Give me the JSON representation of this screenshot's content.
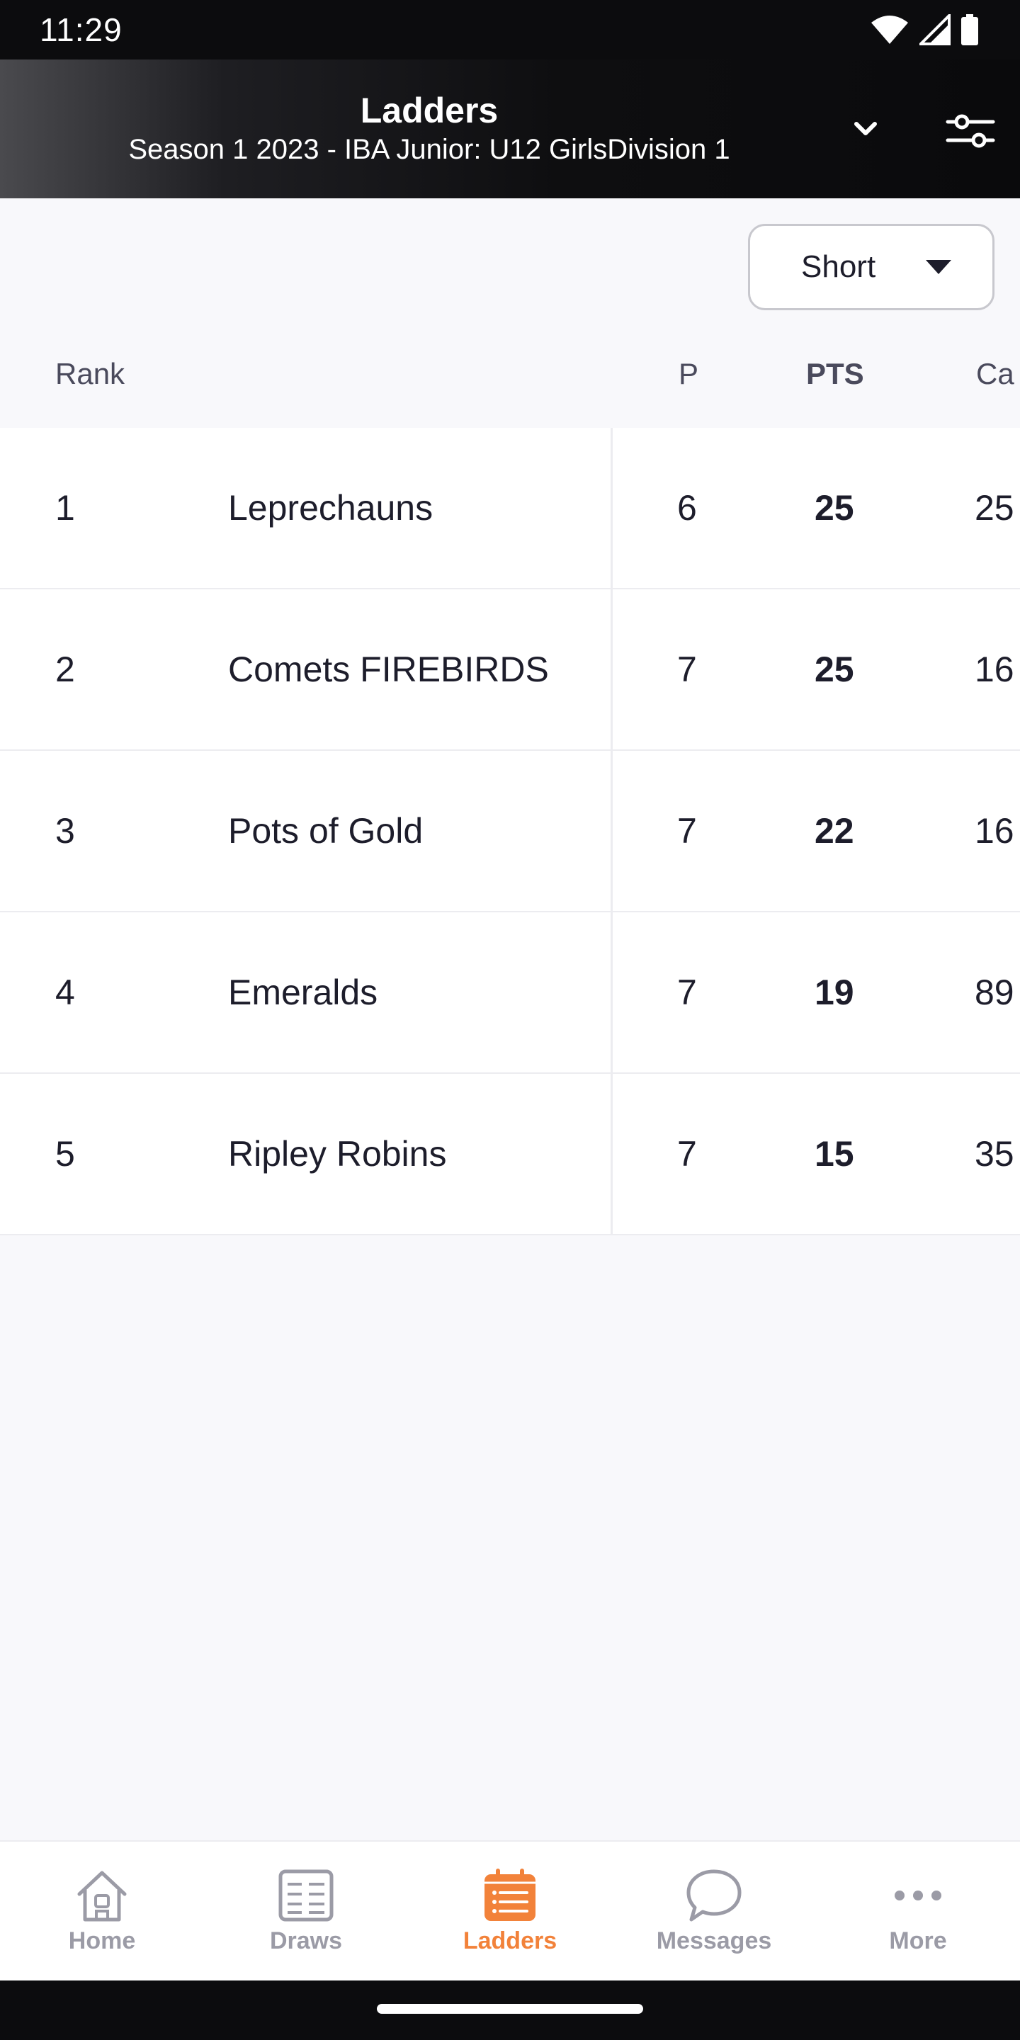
{
  "status_bar": {
    "time": "11:29",
    "icons": [
      "wifi-icon",
      "cellular-signal-icon",
      "battery-icon"
    ]
  },
  "header": {
    "title": "Ladders",
    "subtitle": "Season 1 2023 - IBA Junior: U12 GirlsDivision 1",
    "chevron_icon": "chevron-down-icon",
    "filter_icon": "filter-sliders-icon"
  },
  "view_select": {
    "value": "Short",
    "icon": "caret-down-icon"
  },
  "table": {
    "columns": {
      "rank": "Rank",
      "p": "P",
      "pts": "PTS",
      "extra": "Ca"
    },
    "rows": [
      {
        "rank": "1",
        "team": "Leprechauns",
        "p": "6",
        "pts": "25",
        "extra": "25"
      },
      {
        "rank": "2",
        "team": "Comets FIREBIRDS",
        "p": "7",
        "pts": "25",
        "extra": "16"
      },
      {
        "rank": "3",
        "team": "Pots of Gold",
        "p": "7",
        "pts": "22",
        "extra": "16"
      },
      {
        "rank": "4",
        "team": "Emeralds",
        "p": "7",
        "pts": "19",
        "extra": "89"
      },
      {
        "rank": "5",
        "team": "Ripley Robins",
        "p": "7",
        "pts": "15",
        "extra": "35"
      }
    ]
  },
  "bottom_nav": {
    "items": [
      {
        "label": "Home",
        "icon": "home-icon"
      },
      {
        "label": "Draws",
        "icon": "draws-icon"
      },
      {
        "label": "Ladders",
        "icon": "ladders-icon",
        "active": true
      },
      {
        "label": "Messages",
        "icon": "messages-icon"
      },
      {
        "label": "More",
        "icon": "more-icon"
      }
    ]
  },
  "colors": {
    "accent": "#f2823a",
    "inactive": "#9b9ba6",
    "header_bg": "#0e0e10",
    "page_bg": "#f8f8fb"
  }
}
